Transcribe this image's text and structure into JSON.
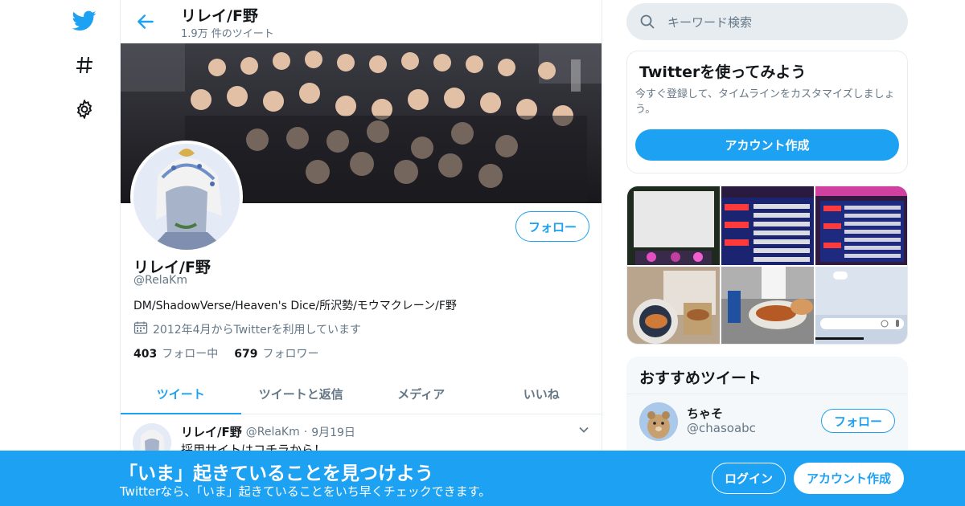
{
  "colors": {
    "accent": "#1da1f2",
    "text": "#14171a",
    "muted": "#657786",
    "border": "#e6ecf0"
  },
  "nav": {
    "icons": [
      "twitter-bird-icon",
      "hashtag-icon",
      "gear-icon"
    ]
  },
  "header": {
    "title": "リレイ/F野",
    "subtitle": "1.9万 件のツイート"
  },
  "profile": {
    "follow_label": "フォロー",
    "name": "リレイ/F野",
    "handle": "@RelaKm",
    "bio": "DM/ShadowVerse/Heaven's Dice/所沢勢/モウマクレーン/F野",
    "joined": "2012年4月からTwitterを利用しています",
    "following_count": "403",
    "following_label": "フォロー中",
    "followers_count": "679",
    "followers_label": "フォロワー"
  },
  "tabs": [
    {
      "label": "ツイート"
    },
    {
      "label": "ツイートと返信"
    },
    {
      "label": "メディア"
    },
    {
      "label": "いいね"
    }
  ],
  "tweet": {
    "name": "リレイ/F野",
    "handle": "@RelaKm",
    "date": "9月19日",
    "text": "採用サイトはコチラから！"
  },
  "search": {
    "placeholder": "キーワード検索"
  },
  "signup_card": {
    "title": "Twitterを使ってみよう",
    "description": "今すぐ登録して、タイムラインをカスタマイズしましょう。",
    "button": "アカウント作成"
  },
  "recommended": {
    "title": "おすすめツイート",
    "name": "ちゃそ",
    "handle": "@chasoabc",
    "button": "フォロー"
  },
  "bottom_bar": {
    "title": "「いま」起きていることを見つけよう",
    "subtitle": "Twitterなら、「いま」起きていることをいち早くチェックできます。",
    "login": "ログイン",
    "signup": "アカウント作成"
  }
}
